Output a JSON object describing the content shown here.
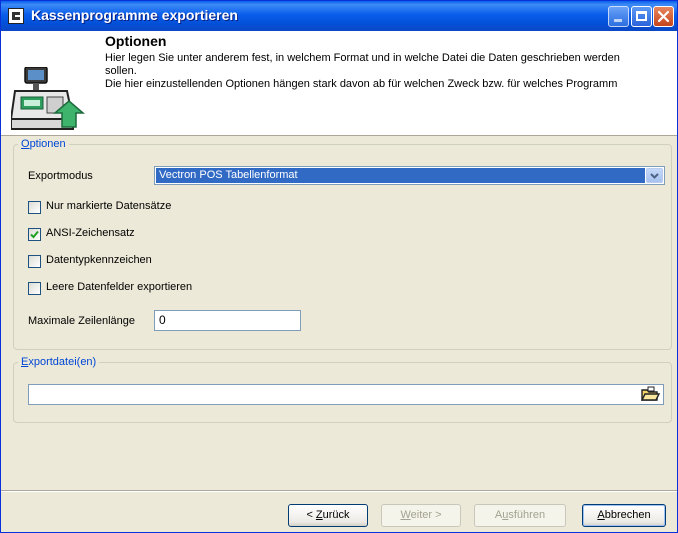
{
  "window": {
    "title": "Kassenprogramme exportieren"
  },
  "header": {
    "title": "Optionen",
    "desc_line1": "Hier legen Sie unter anderem fest, in welchem Format und in welche Datei die Daten geschrieben werden",
    "desc_line2": "sollen.",
    "desc_line3": "Die hier einzustellenden Optionen hängen stark davon ab für welchen Zweck bzw. für welches Programm"
  },
  "options_group": {
    "legend_first": "O",
    "legend_rest": "ptionen",
    "exportmodus_label": "Exportmodus",
    "exportmodus_value": "Vectron POS Tabellenformat",
    "checkboxes": [
      {
        "label": "Nur markierte Datensätze",
        "checked": false
      },
      {
        "label": "ANSI-Zeichensatz",
        "checked": true
      },
      {
        "label": "Datentypkennzeichen",
        "checked": false
      },
      {
        "label": "Leere Datenfelder exportieren",
        "checked": false
      }
    ],
    "max_line_label": "Maximale Zeilenlänge",
    "max_line_value": "0"
  },
  "export_group": {
    "legend_first": "E",
    "legend_rest": "xportdatei(en)",
    "path_value": ""
  },
  "buttons": {
    "back_prefix": "< ",
    "back_underlined": "Z",
    "back_rest": "urück",
    "next_underlined": "W",
    "next_rest": "eiter >",
    "run_prefix": "A",
    "run_underlined": "u",
    "run_rest": "sführen",
    "cancel_underlined": "A",
    "cancel_rest": "bbrechen"
  }
}
